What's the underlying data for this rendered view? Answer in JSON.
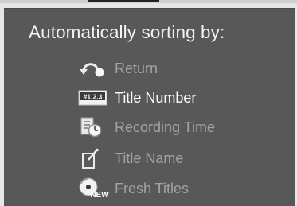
{
  "heading": "Automatically sorting by:",
  "menu": {
    "items": [
      {
        "label": "Return",
        "icon": "return-icon",
        "selected": false
      },
      {
        "label": "Title Number",
        "icon": "number-icon",
        "icon_text": "#1.2.3",
        "selected": true
      },
      {
        "label": "Recording Time",
        "icon": "clock-document-icon",
        "selected": false
      },
      {
        "label": "Title Name",
        "icon": "pen-document-icon",
        "selected": false
      },
      {
        "label": "Fresh Titles",
        "icon": "new-disc-icon",
        "icon_text": "NEW",
        "selected": false
      }
    ]
  },
  "colors": {
    "panel": "#585858",
    "selected_text": "#ffffff",
    "dim_text": "#a3a3a3"
  }
}
